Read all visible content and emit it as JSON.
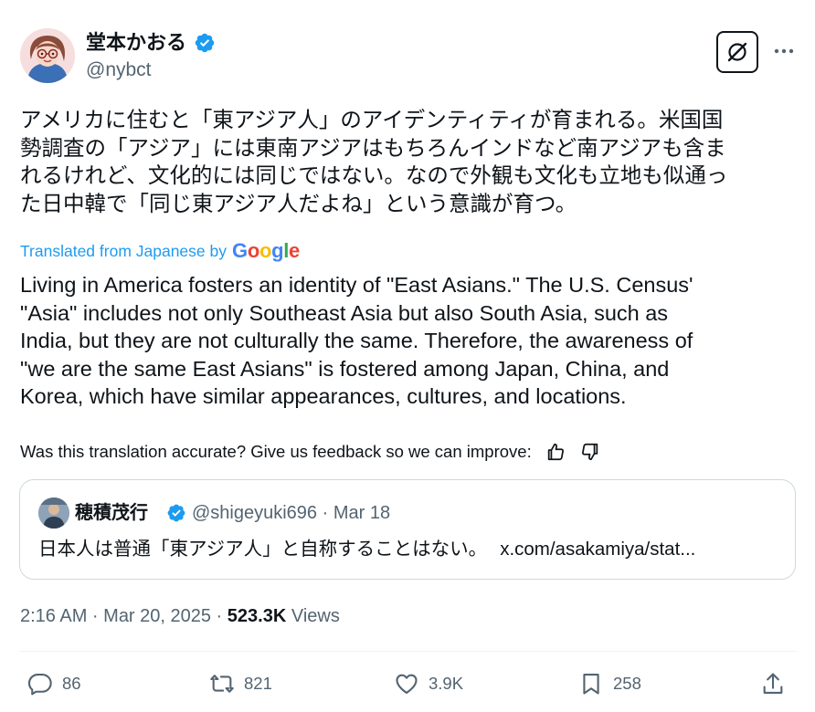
{
  "author": {
    "display_name": "堂本かおる",
    "handle": "@nybct",
    "verified_icon": "verified-badge-icon"
  },
  "header_actions": {
    "grok_icon": "grok-icon",
    "more_icon": "more-dots-icon"
  },
  "tweet": {
    "original_text": "アメリカに住むと「東アジア人」のアイデンティティが育まれる。米国国\n勢調査の「アジア」には東南アジアはもちろんインドなど南アジアも含ま\nれるけれど、文化的には同じではない。なので外観も文化も立地も似通っ\nた日中韓で「同じ東アジア人だよね」という意識が育つ。",
    "translated_from": "Translated from Japanese by",
    "translation_provider": "Google",
    "translated_text": "Living in America fosters an identity of \"East Asians.\" The U.S. Census'\n\"Asia\" includes not only Southeast Asia but also South Asia, such as\nIndia, but they are not culturally the same. Therefore, the awareness of\n\"we are the same East Asians\" is fostered among Japan, China, and\nKorea, which have similar appearances, cultures, and locations.",
    "feedback_prompt": "Was this translation accurate? Give us feedback so we can improve:"
  },
  "quote": {
    "display_name": "穂積茂行",
    "handle_and_date": "@shigeyuki696 · Mar 18",
    "text": "日本人は普通「東アジア人」と自称することはない。",
    "link": "x.com/asakamiya/stat..."
  },
  "meta": {
    "time_date": "2:16 AM · Mar 20, 2025 · ",
    "views_count": "523.3K",
    "views_label": " Views"
  },
  "actions": {
    "replies": "86",
    "reposts": "821",
    "likes": "3.9K",
    "bookmarks": "258"
  },
  "colors": {
    "accent": "#1d9bf0",
    "text_primary": "#0f1419",
    "text_secondary": "#536471",
    "border": "#cfd9de"
  }
}
